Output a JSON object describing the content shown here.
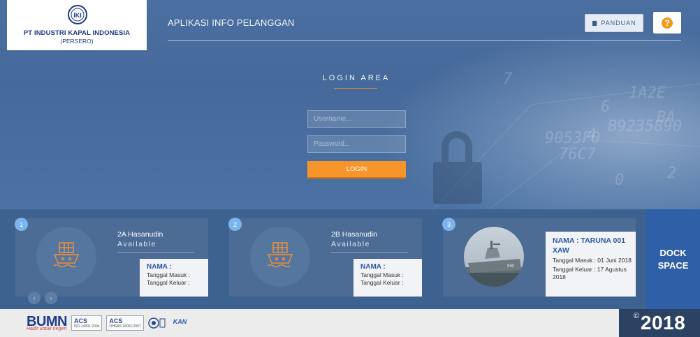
{
  "logo": {
    "emblem": "IKI",
    "company": "PT INDUSTRI KAPAL INDONESIA",
    "subtitle": "(PERSERO)"
  },
  "header": {
    "app_title": "APLIKASI INFO PELANGGAN",
    "guide_label": "PANDUAN",
    "help_label": "?"
  },
  "login": {
    "title": "LOGIN AREA",
    "username_placeholder": "Username...",
    "password_placeholder": "Password...",
    "submit_label": "LOGIN"
  },
  "docks": [
    {
      "number": "1",
      "name": "2A Hasanudin",
      "status": "Available",
      "nama_label": "NAMA :",
      "masuk_label": "Tanggal Masuk :",
      "keluar_label": "Tanggal Keluar :"
    },
    {
      "number": "2",
      "name": "2B Hasanudin",
      "status": "Available",
      "nama_label": "NAMA :",
      "masuk_label": "Tanggal Masuk :",
      "keluar_label": "Tanggal Keluar :"
    },
    {
      "number": "3",
      "nama": "NAMA : TARUNA 001 XAW",
      "masuk": "Tanggal Masuk : 01 Juni 2018",
      "keluar": "Tanggal Keluar : 17 Agustus 2018"
    }
  ],
  "carousel": {
    "prev": "‹",
    "next": "›"
  },
  "dock_space": {
    "line1": "DOCK",
    "line2": "SPACE"
  },
  "footer": {
    "bumn": "BUMN",
    "bumn_tagline": "Hadir untuk negeri",
    "cert1": {
      "top": "ACS",
      "bottom": "ISO 14001:2004"
    },
    "cert2": {
      "top": "ACS",
      "bottom": "OHSAS 18001:2007"
    },
    "kan": "KAN",
    "year": "2018",
    "copyright": "©"
  },
  "colors": {
    "accent_orange": "#f7952b",
    "brand_blue": "#2f5fa7",
    "badge_blue": "#7bb4ef",
    "help_orange": "#f19a1b"
  },
  "icons": {
    "guide": "book-icon",
    "help": "question-icon",
    "dock": "cargo-ship-icon"
  }
}
